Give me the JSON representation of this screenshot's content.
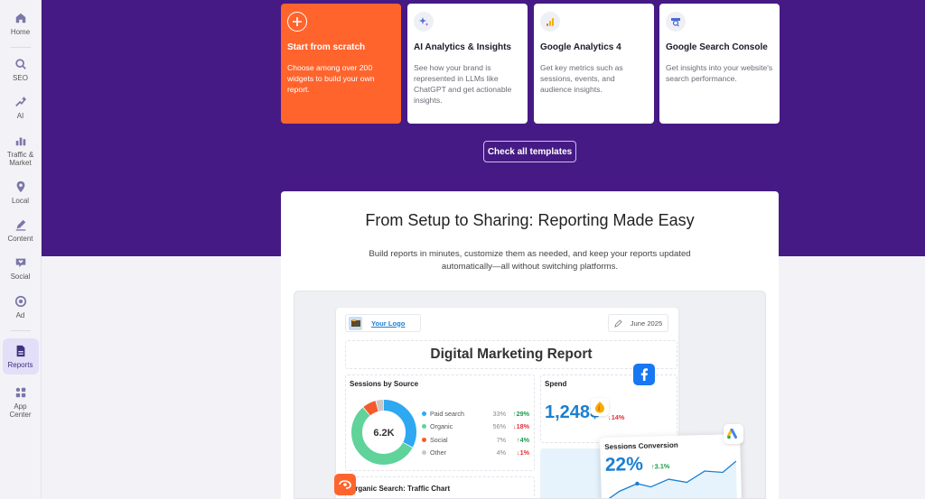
{
  "sidebar": {
    "items": [
      {
        "label": "Home",
        "icon": "home-icon"
      },
      {
        "label": "SEO",
        "icon": "seo-icon"
      },
      {
        "label": "AI",
        "icon": "ai-icon"
      },
      {
        "label": "Traffic & Market",
        "icon": "traffic-icon"
      },
      {
        "label": "Local",
        "icon": "location-pin-icon"
      },
      {
        "label": "Content",
        "icon": "pencil-icon"
      },
      {
        "label": "Social",
        "icon": "heart-chat-icon"
      },
      {
        "label": "Ad",
        "icon": "ad-target-icon"
      },
      {
        "label": "Reports",
        "icon": "report-document-icon"
      },
      {
        "label": "App Center",
        "icon": "apps-grid-icon"
      }
    ],
    "active": "Reports"
  },
  "templates": [
    {
      "title": "Start from scratch",
      "desc": "Choose among over 200 widgets to build your own report.",
      "icon": "plus-icon"
    },
    {
      "title": "AI Analytics & Insights",
      "desc": "See how your brand is represented in LLMs like ChatGPT and get actionable insights.",
      "icon": "sparkle-icon"
    },
    {
      "title": "Google Analytics 4",
      "desc": "Get key metrics such as sessions, events, and audience insights.",
      "icon": "google-analytics-icon"
    },
    {
      "title": "Google Search Console",
      "desc": "Get insights into your website's search performance.",
      "icon": "search-console-icon"
    }
  ],
  "check_templates_label": "Check all templates",
  "section": {
    "title": "From Setup to Sharing: Reporting Made Easy",
    "subtitle": "Build reports in minutes, customize them as needed, and keep your reports updated automatically—all without switching platforms."
  },
  "report": {
    "logo_label": "Your Logo",
    "date": "June 2025",
    "title": "Digital Marketing Report",
    "sessions": {
      "title": "Sessions by Source",
      "total": "6.2K",
      "rows": [
        {
          "name": "Paid search",
          "pct": "33%",
          "change": "↑29%",
          "dir": "up",
          "color": "#2ea8f0"
        },
        {
          "name": "Organic",
          "pct": "56%",
          "change": "↓18%",
          "dir": "down",
          "color": "#5fd39a"
        },
        {
          "name": "Social",
          "pct": "7%",
          "change": "↑4%",
          "dir": "up",
          "color": "#f45b2c"
        },
        {
          "name": "Other",
          "pct": "4%",
          "change": "↓1%",
          "dir": "down",
          "color": "#c8c8c8"
        }
      ]
    },
    "spend": {
      "title": "Spend",
      "value": "1,248$",
      "change": "↓14%"
    },
    "organic_title": "Organic Search: Traffic Chart",
    "conversion": {
      "title": "Sessions Conversion",
      "value": "22%",
      "change": "↑3.1%"
    }
  }
}
